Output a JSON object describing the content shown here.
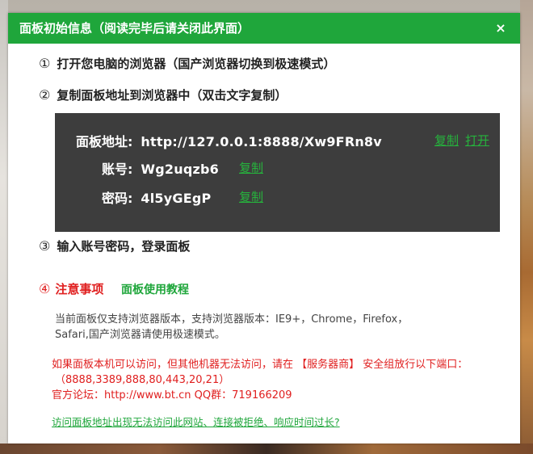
{
  "dialog": {
    "title": "面板初始信息（阅读完毕后请关闭此界面）",
    "close_glyph": "×"
  },
  "steps": [
    {
      "num": "①",
      "text": "打开您电脑的浏览器（国产浏览器切换到极速模式）"
    },
    {
      "num": "②",
      "text": "复制面板地址到浏览器中（双击文字复制）"
    },
    {
      "num": "③",
      "text": "输入账号密码，登录面板"
    }
  ],
  "panel": {
    "address_label": "面板地址:",
    "address_value": "http://127.0.0.1:8888/Xw9FRn8v",
    "copy_label": "复制",
    "open_label": "打开",
    "account_label": "账号:",
    "account_value": "Wg2uqzb6",
    "password_label": "密码:",
    "password_value": "4l5yGEgP"
  },
  "notice": {
    "num": "④",
    "title": "注意事项",
    "tutorial_label": "面板使用教程",
    "browser_line1": "当前面板仅支持浏览器版本，支持浏览器版本：IE9+，Chrome，Firefox，",
    "browser_line2": "Safari,国产浏览器请使用极速模式。",
    "port_line1": "如果面板本机可以访问，但其他机器无法访问，请在 【服务器商】 安全组放行以下端口：",
    "port_line2": "（8888,3389,888,80,443,20,21）",
    "forum_line": "官方论坛：http://www.bt.cn  QQ群：719166209",
    "help_link": "访问面板地址出现无法访问此网站、连接被拒绝、响应时间过长?"
  },
  "colors": {
    "accent_green": "#1fa63b",
    "link_green": "#26b33d",
    "warning_red": "#e02020",
    "panel_bg": "#3d3d3d"
  }
}
